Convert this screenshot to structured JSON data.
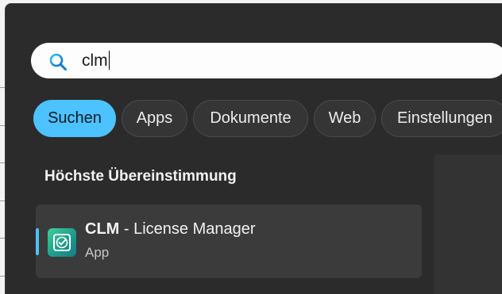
{
  "search": {
    "query": "clm",
    "icon": "search-icon"
  },
  "filters": [
    {
      "label": "Suchen",
      "active": true
    },
    {
      "label": "Apps",
      "active": false
    },
    {
      "label": "Dokumente",
      "active": false
    },
    {
      "label": "Web",
      "active": false
    },
    {
      "label": "Einstellungen",
      "active": false
    }
  ],
  "best_match": {
    "section_title": "Höchste Übereinstimmung",
    "app_name_bold": "CLM",
    "app_name_rest": " - License Manager",
    "app_type": "App",
    "icon": "license-manager-app-icon"
  },
  "colors": {
    "accent": "#4cc2ff",
    "panel": "#2b2b2b",
    "result_bg": "#3b3b3b"
  }
}
